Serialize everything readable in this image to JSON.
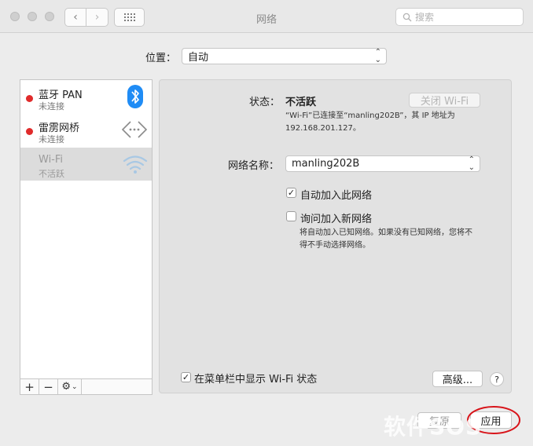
{
  "window": {
    "title": "网络"
  },
  "search": {
    "placeholder": "搜索"
  },
  "location": {
    "label": "位置：",
    "value": "自动"
  },
  "services": [
    {
      "name": "蓝牙 PAN",
      "status": "未连接",
      "icon": "bluetooth-icon"
    },
    {
      "name": "雷雳网桥",
      "status": "未连接",
      "icon": "thunderbolt-bridge-icon"
    },
    {
      "name": "Wi-Fi",
      "status": "不活跃",
      "icon": "wifi-icon"
    }
  ],
  "list_toolbar": {
    "add": "+",
    "remove": "−",
    "gear": "⚙"
  },
  "detail": {
    "status_label": "状态：",
    "status_value": "不活跃",
    "toggle_button": "关闭 Wi-Fi",
    "status_desc_line1": "“Wi-Fi”已连接至“manling202B”，其 IP 地址为",
    "status_desc_line2": "192.168.201.127。",
    "network_name_label": "网络名称：",
    "network_name_value": "manling202B",
    "auto_join_label": "自动加入此网络",
    "auto_join_checked": true,
    "ask_join_label": "询问加入新网络",
    "ask_join_checked": false,
    "ask_join_desc_line1": "将自动加入已知网络。如果没有已知网络，您将不",
    "ask_join_desc_line2": "得不手动选择网络。",
    "menubar_label": "在菜单栏中显示 Wi-Fi 状态",
    "menubar_checked": true,
    "advanced_button": "高级...",
    "help_button": "?"
  },
  "footer": {
    "revert_button": "复原",
    "apply_button": "应用"
  },
  "watermark": "软件SOS",
  "colors": {
    "status_dot": "#e02b2b",
    "bluetooth": "#1f8cf5",
    "highlight_circle": "#d8141a"
  }
}
